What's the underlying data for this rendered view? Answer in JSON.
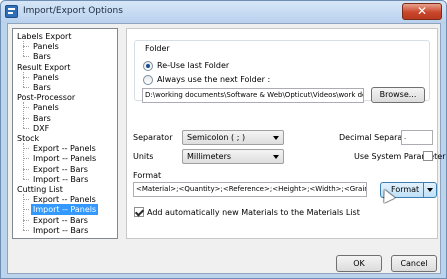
{
  "window": {
    "title": "Import/Export Options",
    "close_label": "✕"
  },
  "tree": {
    "items": [
      {
        "label": "Labels Export",
        "level": 0
      },
      {
        "label": "Panels",
        "level": 1
      },
      {
        "label": "Bars",
        "level": 1
      },
      {
        "label": "Result Export",
        "level": 0
      },
      {
        "label": "Panels",
        "level": 1
      },
      {
        "label": "Bars",
        "level": 1
      },
      {
        "label": "Post-Processor",
        "level": 0
      },
      {
        "label": "Panels",
        "level": 1
      },
      {
        "label": "Bars",
        "level": 1
      },
      {
        "label": "DXF",
        "level": 1
      },
      {
        "label": "Stock",
        "level": 0
      },
      {
        "label": "Export -- Panels",
        "level": 1
      },
      {
        "label": "Import -- Panels",
        "level": 1
      },
      {
        "label": "Export -- Bars",
        "level": 1
      },
      {
        "label": "Import -- Bars",
        "level": 1
      },
      {
        "label": "Cutting List",
        "level": 0
      },
      {
        "label": "Export -- Panels",
        "level": 1
      },
      {
        "label": "Import -- Panels",
        "level": 1,
        "selected": true
      },
      {
        "label": "Export -- Bars",
        "level": 1
      },
      {
        "label": "Import -- Bars",
        "level": 1
      }
    ]
  },
  "folder": {
    "group_label": "Folder",
    "option_reuse": "Re-Use last Folder",
    "option_next": "Always use the next Folder :",
    "path_value": "D:\\working documents\\Software & Web\\Opticut\\Videos\\work doc",
    "browse_label": "Browse..."
  },
  "settings": {
    "separator_label": "Separator",
    "separator_value": "Semicolon  ( ; )",
    "decimal_label": "Decimal Separator",
    "decimal_value": ".",
    "units_label": "Units",
    "units_value": "Millimeters",
    "system_param_label": "Use System Parameter"
  },
  "format": {
    "label": "Format",
    "value": "<Material>;<Quantity>;<Reference>;<Height>;<Width>;<Grain Direction>",
    "button_label": "Format",
    "auto_add_label": "Add automatically new Materials to the Materials List"
  },
  "footer": {
    "ok_label": "OK",
    "cancel_label": "Cancel"
  },
  "colors": {
    "selection": "#3399ff",
    "close_button": "#c9462b",
    "title_bar": "#b9d1ee"
  }
}
